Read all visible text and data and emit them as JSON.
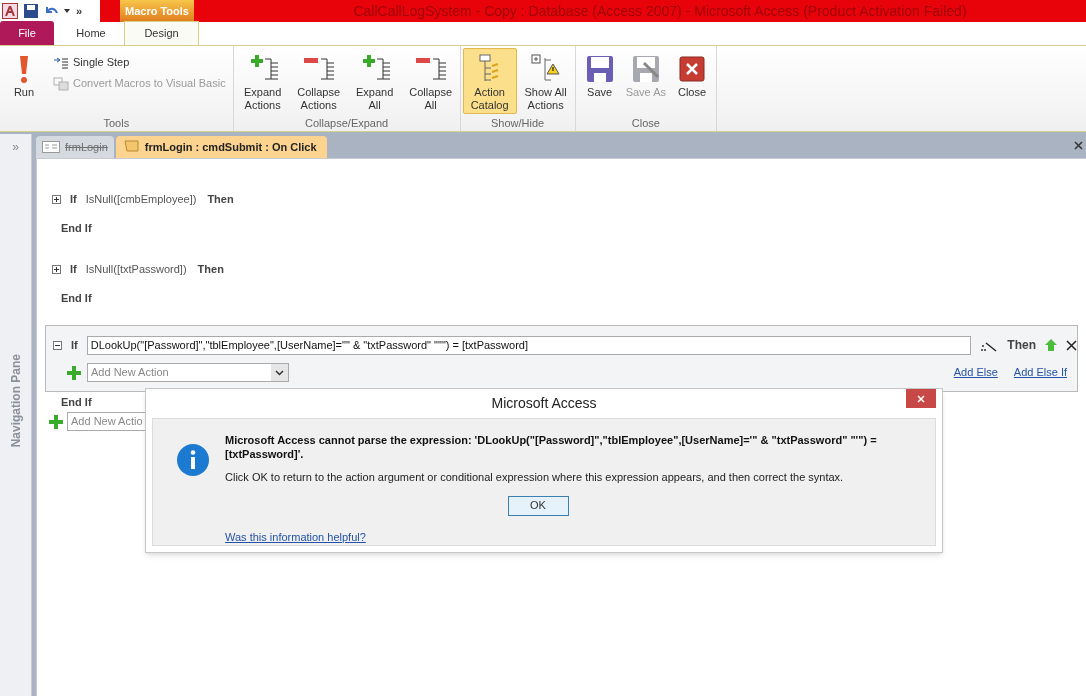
{
  "quick_access": {
    "more": "»"
  },
  "window": {
    "title": "CallCallLogSystem - Copy : Database (Access 2007)  -  Microsoft Access (Product Activation Failed)",
    "context_tab": "Macro Tools"
  },
  "ribbon_tabs": [
    {
      "label": "File",
      "kind": "file",
      "selected": false
    },
    {
      "label": "Home",
      "kind": "tab",
      "selected": false
    },
    {
      "label": "Design",
      "kind": "tab",
      "selected": true
    }
  ],
  "ribbon_groups": [
    {
      "label": "Tools",
      "buttons": [
        {
          "label": "Run",
          "kind": "large",
          "disabled": false,
          "selected": false
        },
        {
          "label": "Single Step",
          "kind": "small",
          "disabled": false,
          "selected": false
        },
        {
          "label": "Convert Macros to Visual Basic",
          "kind": "small",
          "disabled": true,
          "selected": false
        }
      ]
    },
    {
      "label": "Collapse/Expand",
      "buttons": [
        {
          "label": "Expand Actions",
          "kind": "large",
          "disabled": false,
          "selected": false
        },
        {
          "label": "Collapse Actions",
          "kind": "large",
          "disabled": false,
          "selected": false
        },
        {
          "label": "Expand All",
          "kind": "large",
          "disabled": false,
          "selected": false
        },
        {
          "label": "Collapse All",
          "kind": "large",
          "disabled": false,
          "selected": false
        }
      ]
    },
    {
      "label": "Show/Hide",
      "buttons": [
        {
          "label": "Action Catalog",
          "kind": "large",
          "disabled": false,
          "selected": true
        },
        {
          "label": "Show All Actions",
          "kind": "large",
          "disabled": false,
          "selected": false
        }
      ]
    },
    {
      "label": "Close",
      "buttons": [
        {
          "label": "Save",
          "kind": "large",
          "disabled": false,
          "selected": false
        },
        {
          "label": "Save As",
          "kind": "large",
          "disabled": true,
          "selected": false
        },
        {
          "label": "Close",
          "kind": "large",
          "disabled": false,
          "selected": false
        }
      ]
    }
  ],
  "nav_pane": {
    "toggle": "»",
    "label": "Navigation Pane"
  },
  "document_tabs": [
    {
      "label": "frmLogin",
      "kind": "form",
      "selected": false
    },
    {
      "label": "frmLogin : cmdSubmit : On Click",
      "kind": "macro",
      "selected": true
    }
  ],
  "macro": {
    "blocks": [
      {
        "expanded": false,
        "keyword": "If",
        "condition": "IsNull([cmbEmployee])",
        "then": "Then",
        "end": "End If"
      },
      {
        "expanded": false,
        "keyword": "If",
        "condition": "IsNull([txtPassword])",
        "then": "Then",
        "end": "End If"
      },
      {
        "expanded": true,
        "keyword": "If",
        "condition": "DLookUp(\"[Password]\",\"tblEmployee\",[UserName]=\"\" & \"txtPassword\" \"\"\") = [txtPassword]",
        "then": "Then",
        "action_placeholder": "Add New Action",
        "add_else": "Add Else",
        "add_else_if": "Add Else If",
        "end": "End If"
      }
    ],
    "add_action_placeholder": "Add New Actio"
  },
  "dialog": {
    "title": "Microsoft Access",
    "message_bold": "Microsoft Access cannot parse the expression: 'DLookUp(\"[Password]\",\"tblEmployee\",[UserName]='\" & \"txtPassword\" \"'\") = [txtPassword]'.",
    "message": "Click OK to return to the action argument or conditional expression where this expression appears, and then correct the syntax.",
    "ok": "OK",
    "help_link": "Was this information helpful?"
  }
}
